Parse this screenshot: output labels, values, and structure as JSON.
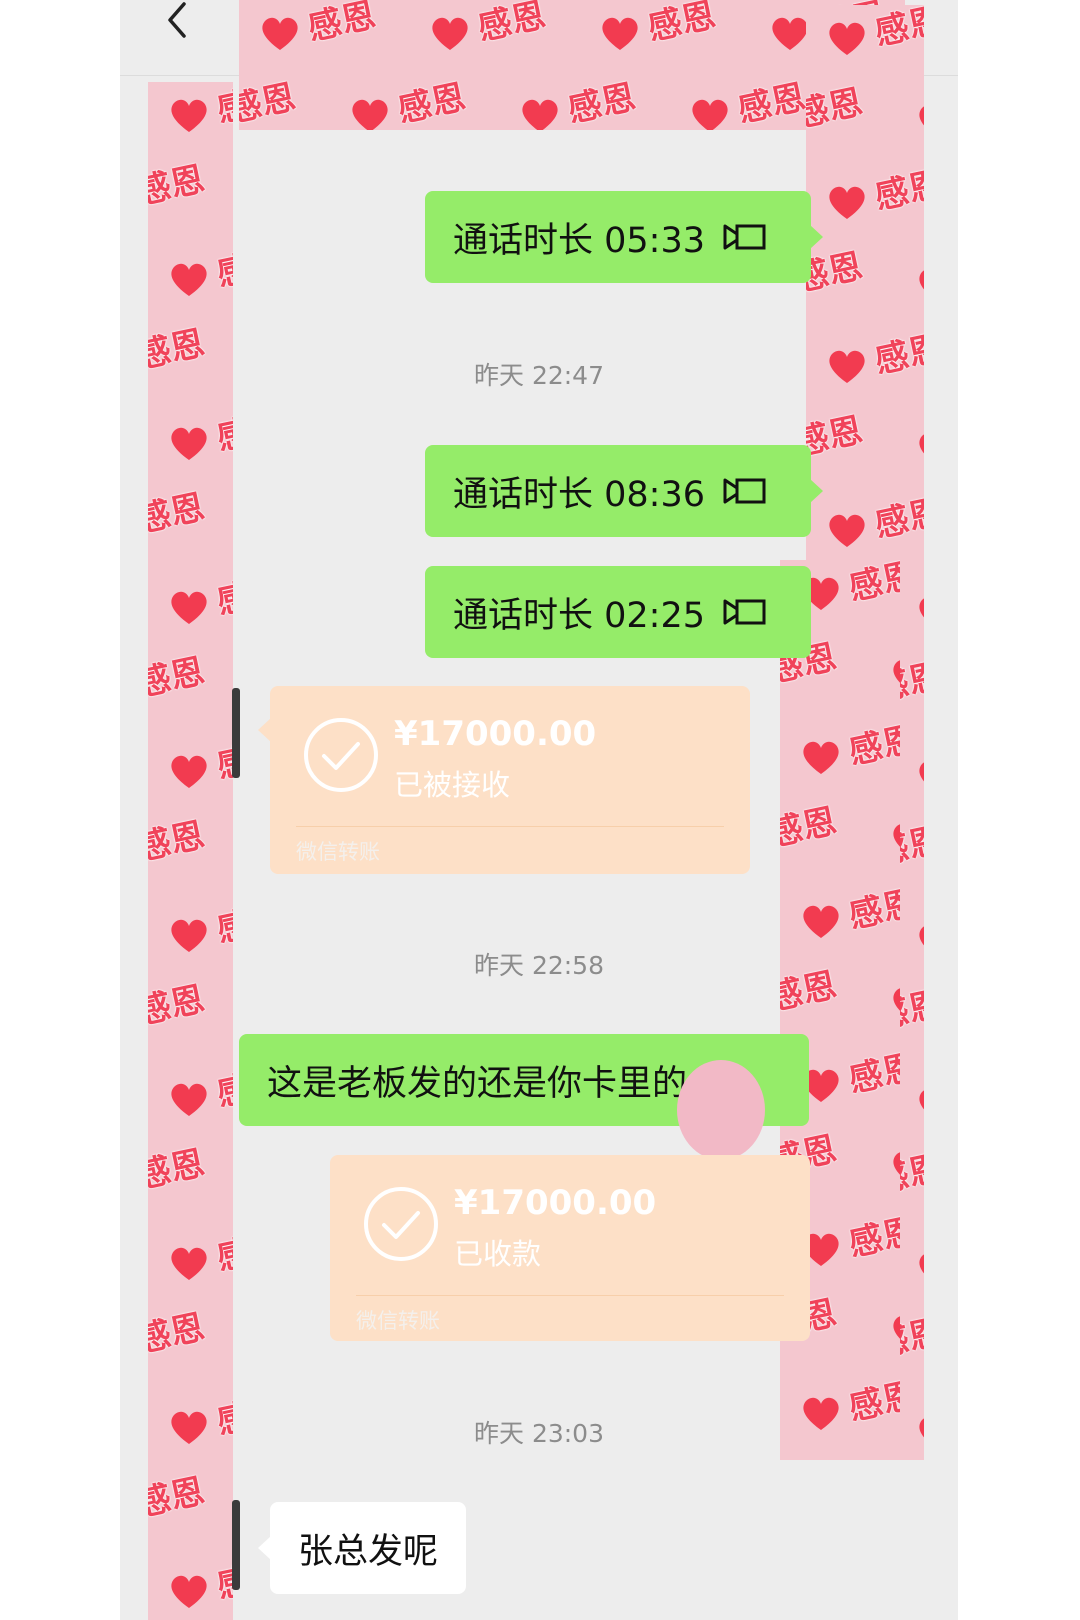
{
  "chat": {
    "messages": [
      {
        "type": "call",
        "text": "通话时长 05:33",
        "icon": "video-call-icon"
      },
      {
        "type": "time",
        "text": "昨天 22:47"
      },
      {
        "type": "call",
        "text": "通话时长 08:36",
        "icon": "video-call-icon"
      },
      {
        "type": "call",
        "text": "通话时长 02:25",
        "icon": "video-call-icon"
      },
      {
        "type": "transfer",
        "amount": "¥17000.00",
        "status": "已被接收",
        "brand": "微信转账"
      },
      {
        "type": "time",
        "text": "昨天 22:58"
      },
      {
        "type": "text",
        "text": "这是老板发的还是你卡里的"
      },
      {
        "type": "transfer",
        "amount": "¥17000.00",
        "status": "已收款",
        "brand": "微信转账"
      },
      {
        "type": "time",
        "text": "昨天 23:03"
      },
      {
        "type": "text",
        "text": "张总发呢"
      }
    ]
  },
  "sticker": {
    "word": "感恩",
    "icon": "heart-icon"
  },
  "colors": {
    "background": "#ededed",
    "sent_bubble": "#95ec69",
    "transfer_card": "#fde0c7",
    "sticker_pink": "#f4c7cf",
    "sticker_text": "#f0435a"
  },
  "header": {
    "back_icon": "chevron-left-icon"
  }
}
